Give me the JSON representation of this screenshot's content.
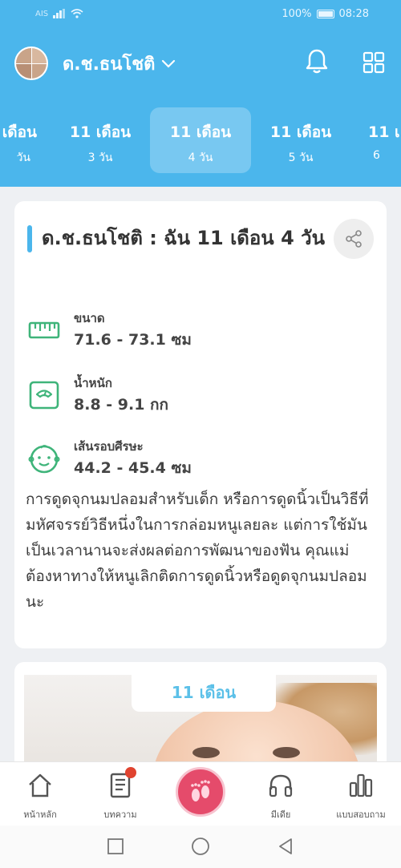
{
  "status_bar": {
    "carrier": "AIS",
    "battery": "100%",
    "time": "08:28"
  },
  "header": {
    "profile_name": "ด.ช.ธนโชติ",
    "age_tabs": [
      {
        "month": "เดือน",
        "day": "วัน"
      },
      {
        "month": "11 เดือน",
        "day": "3 วัน"
      },
      {
        "month": "11 เดือน",
        "day": "4 วัน",
        "active": true
      },
      {
        "month": "11 เดือน",
        "day": "5 วัน"
      },
      {
        "month": "11 เ",
        "day": "6 "
      }
    ]
  },
  "card": {
    "title": "ด.ช.ธนโชติ : ฉัน 11 เดือน 4 วัน",
    "metrics": [
      {
        "icon": "ruler-icon",
        "label": "ขนาด",
        "value": "71.6 - 73.1 ซม"
      },
      {
        "icon": "scale-icon",
        "label": "น้ำหนัก",
        "value": "8.8 - 9.1 กก"
      },
      {
        "icon": "baby-face-icon",
        "label": "เส้นรอบศีรษะ",
        "value": "44.2 - 45.4 ซม"
      }
    ],
    "body": "การดูดจุกนมปลอมสำหรับเด็ก หรือการดูดนิ้วเป็นวิธีที่มหัศจรรย์วิธีหนึ่งในการกล่อมหนูเลยละ แต่การใช้มันเป็นเวลานานจะส่งผลต่อการพัฒนาของฟัน คุณแม่ต้องหาทางให้หนูเลิกติดการดูดนิ้วหรือดูดจุกนมปลอมนะ"
  },
  "photo_card": {
    "label": "11 เดือน"
  },
  "bottom_nav": {
    "home": "หน้าหลัก",
    "articles": "บทความ",
    "media": "มีเดีย",
    "survey": "แบบสอบถาม"
  },
  "colors": {
    "brand": "#4bb6ec",
    "metric_icon": "#3fb47a",
    "center_button": "#e54b6b",
    "badge": "#e0432f"
  }
}
